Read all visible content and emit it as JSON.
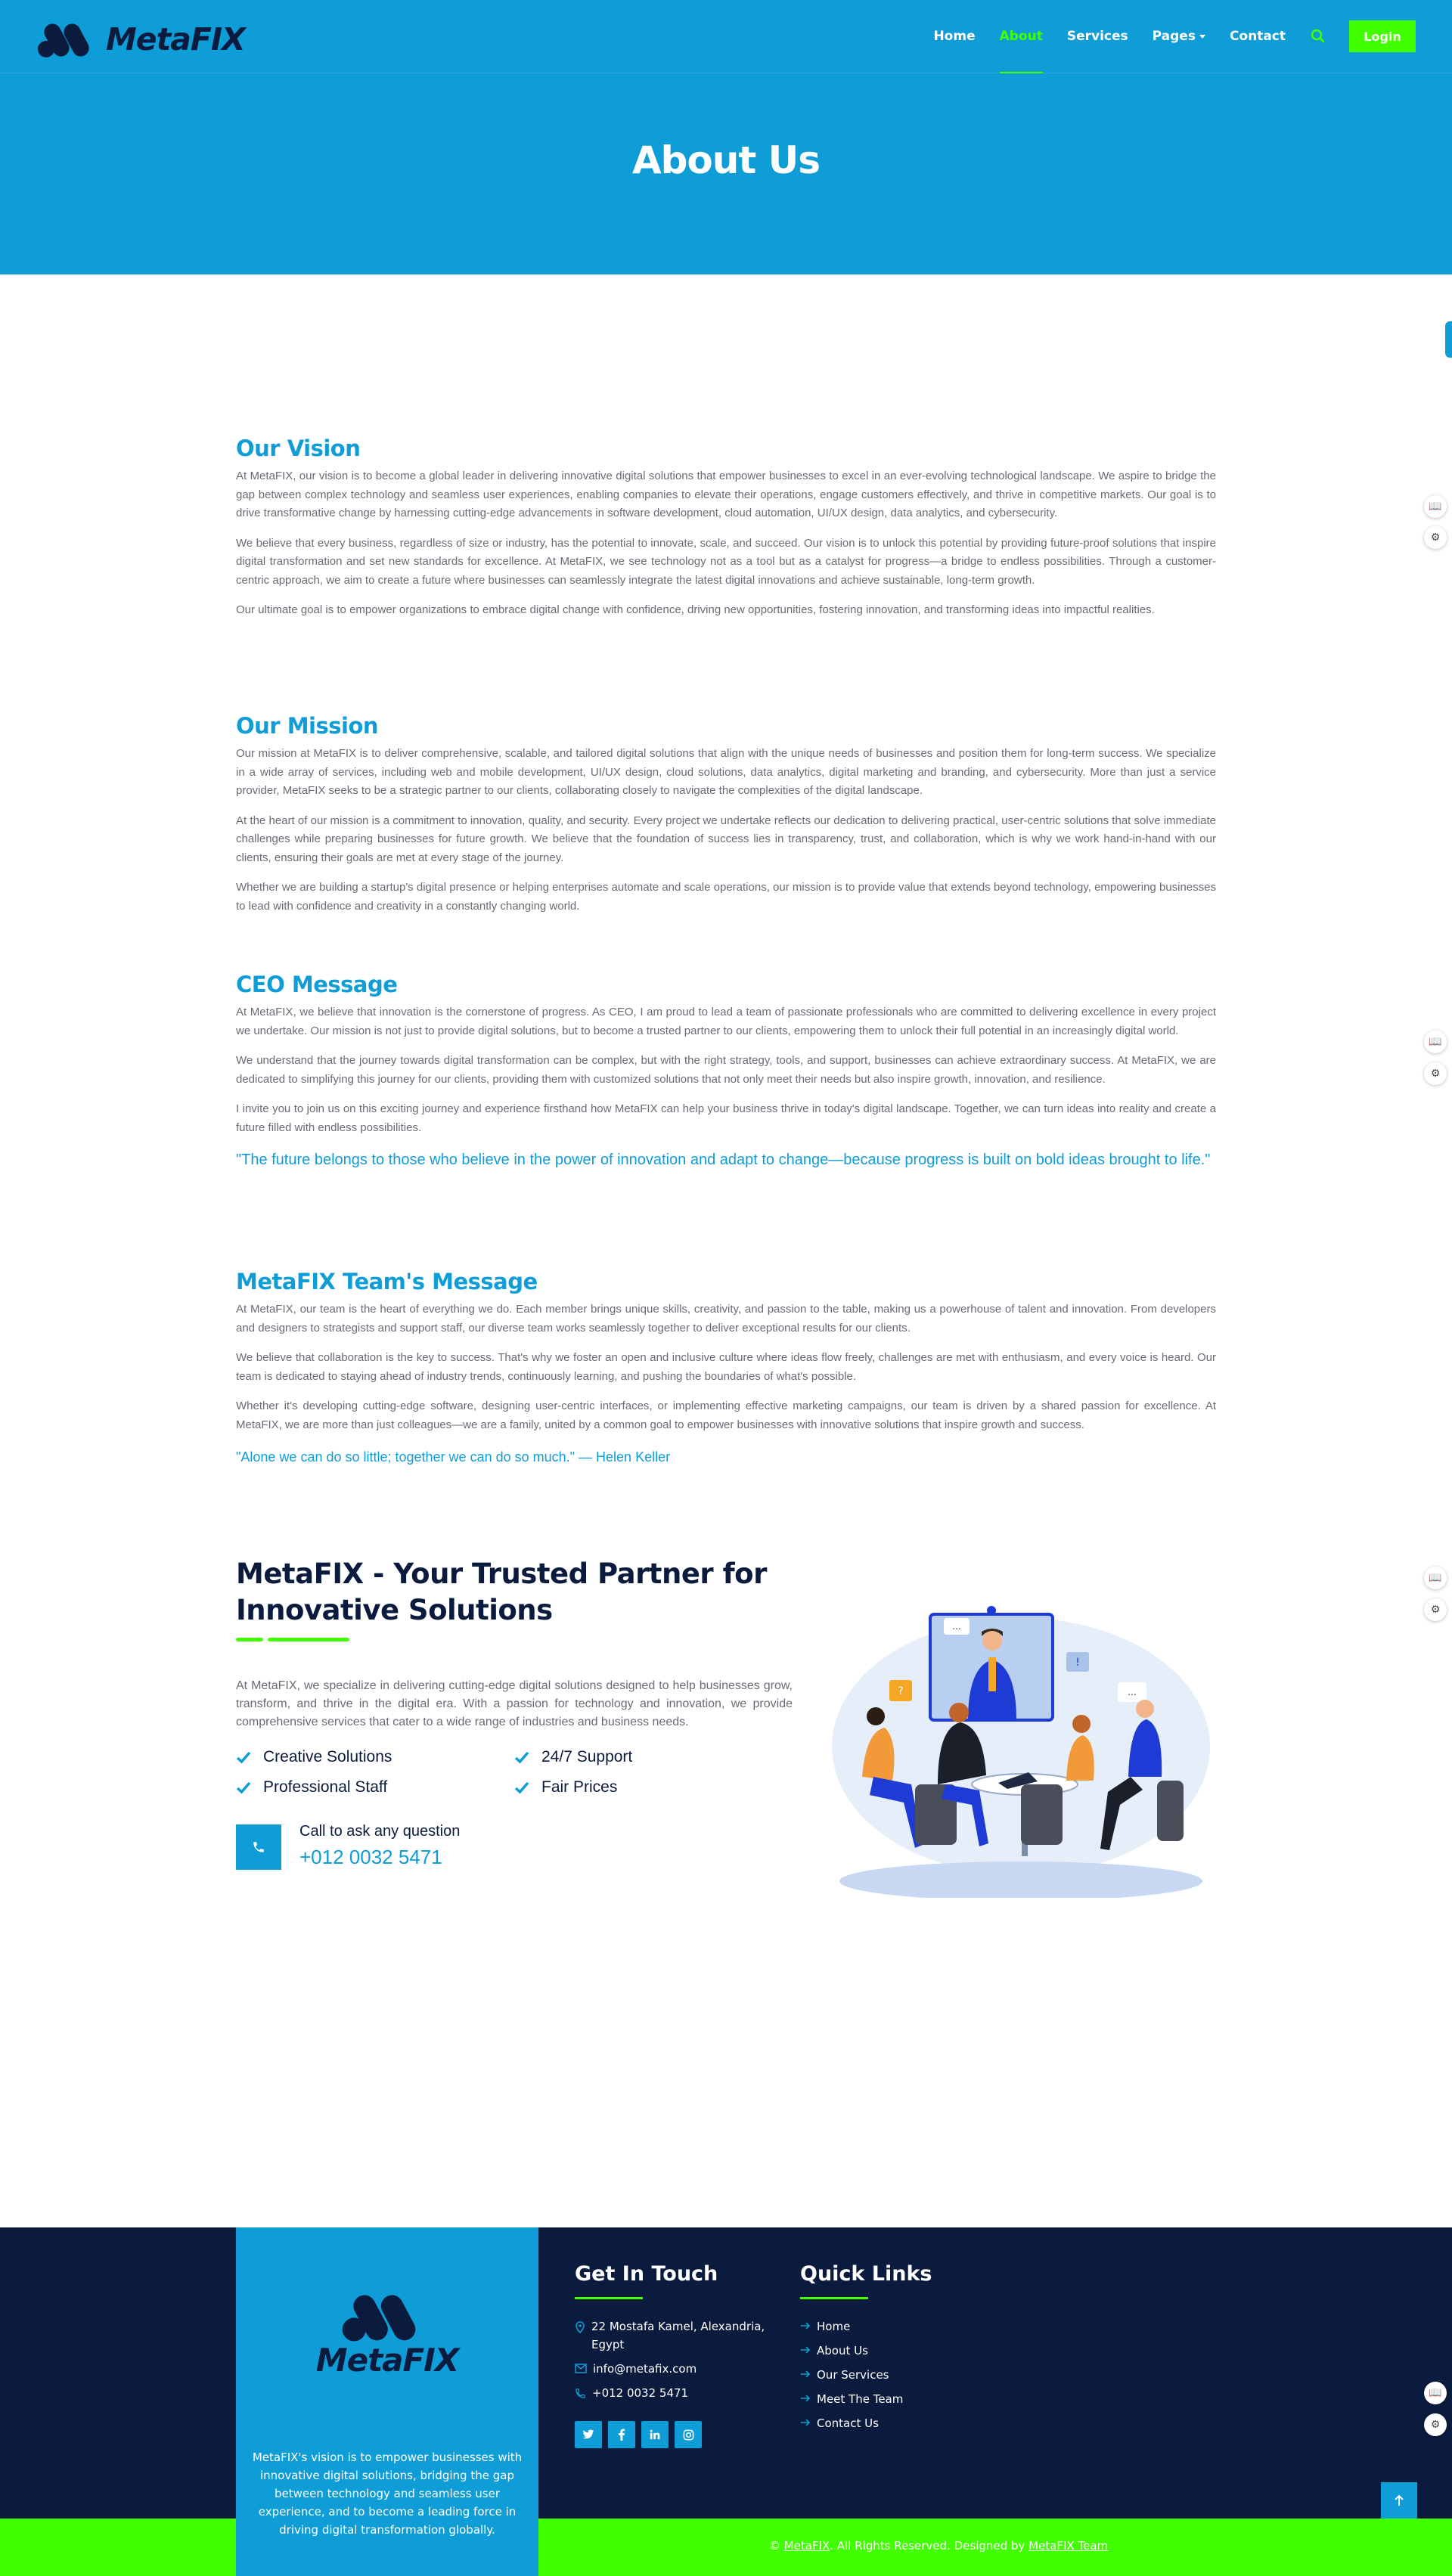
{
  "brand": {
    "name": "MetaFIX",
    "color_primary": "#0F9DD8",
    "color_accent": "#42FF00",
    "color_dark": "#0B1B3D"
  },
  "nav": {
    "items": [
      {
        "label": "Home",
        "active": false
      },
      {
        "label": "About",
        "active": true
      },
      {
        "label": "Services",
        "active": false
      },
      {
        "label": "Pages",
        "active": false
      },
      {
        "label": "Contact",
        "active": false
      }
    ],
    "search_icon": "search-icon",
    "login_label": "Login"
  },
  "hero": {
    "title": "About Us"
  },
  "vision": {
    "title": "Our Vision",
    "paragraphs": [
      "At MetaFIX, our vision is to become a global leader in delivering innovative digital solutions that empower businesses to excel in an ever-evolving technological landscape. We aspire to bridge the gap between complex technology and seamless user experiences, enabling companies to elevate their operations, engage customers effectively, and thrive in competitive markets. Our goal is to drive transformative change by harnessing cutting-edge advancements in software development, cloud automation, UI/UX design, data analytics, and cybersecurity.",
      "We believe that every business, regardless of size or industry, has the potential to innovate, scale, and succeed. Our vision is to unlock this potential by providing future-proof solutions that inspire digital transformation and set new standards for excellence. At MetaFIX, we see technology not as a tool but as a catalyst for progress—a bridge to endless possibilities. Through a customer-centric approach, we aim to create a future where businesses can seamlessly integrate the latest digital innovations and achieve sustainable, long-term growth.",
      "Our ultimate goal is to empower organizations to embrace digital change with confidence, driving new opportunities, fostering innovation, and transforming ideas into impactful realities."
    ]
  },
  "mission": {
    "title": "Our Mission",
    "paragraphs": [
      "Our mission at MetaFIX is to deliver comprehensive, scalable, and tailored digital solutions that align with the unique needs of businesses and position them for long-term success. We specialize in a wide array of services, including web and mobile development, UI/UX design, cloud solutions, data analytics, digital marketing and branding, and cybersecurity. More than just a service provider, MetaFIX seeks to be a strategic partner to our clients, collaborating closely to navigate the complexities of the digital landscape.",
      "At the heart of our mission is a commitment to innovation, quality, and security. Every project we undertake reflects our dedication to delivering practical, user-centric solutions that solve immediate challenges while preparing businesses for future growth. We believe that the foundation of success lies in transparency, trust, and collaboration, which is why we work hand-in-hand with our clients, ensuring their goals are met at every stage of the journey.",
      "Whether we are building a startup's digital presence or helping enterprises automate and scale operations, our mission is to provide value that extends beyond technology, empowering businesses to lead with confidence and creativity in a constantly changing world."
    ]
  },
  "ceo": {
    "title": "CEO Message",
    "paragraphs": [
      "At MetaFIX, we believe that innovation is the cornerstone of progress. As CEO, I am proud to lead a team of passionate professionals who are committed to delivering excellence in every project we undertake. Our mission is not just to provide digital solutions, but to become a trusted partner to our clients, empowering them to unlock their full potential in an increasingly digital world.",
      "We understand that the journey towards digital transformation can be complex, but with the right strategy, tools, and support, businesses can achieve extraordinary success. At MetaFIX, we are dedicated to simplifying this journey for our clients, providing them with customized solutions that not only meet their needs but also inspire growth, innovation, and resilience.",
      "I invite you to join us on this exciting journey and experience firsthand how MetaFIX can help your business thrive in today's digital landscape. Together, we can turn ideas into reality and create a future filled with endless possibilities."
    ],
    "quote": "\"The future belongs to those who believe in the power of innovation and adapt to change—because progress is built on bold ideas brought to life.\""
  },
  "team": {
    "title": "MetaFIX Team's Message",
    "paragraphs": [
      "At MetaFIX, our team is the heart of everything we do. Each member brings unique skills, creativity, and passion to the table, making us a powerhouse of talent and innovation. From developers and designers to strategists and support staff, our diverse team works seamlessly together to deliver exceptional results for our clients.",
      "We believe that collaboration is the key to success. That's why we foster an open and inclusive culture where ideas flow freely, challenges are met with enthusiasm, and every voice is heard. Our team is dedicated to staying ahead of industry trends, continuously learning, and pushing the boundaries of what's possible.",
      "Whether it's developing cutting-edge software, designing user-centric interfaces, or implementing effective marketing campaigns, our team is driven by a shared passion for excellence. At MetaFIX, we are more than just colleagues—we are a family, united by a common goal to empower businesses with innovative solutions that inspire growth and success."
    ],
    "quote": "\"Alone we can do so little; together we can do so much.\" — Helen Keller"
  },
  "about": {
    "title_line1": "MetaFIX - Your Trusted Partner for",
    "title_line2": "Innovative Solutions",
    "text": "At MetaFIX, we specialize in delivering cutting-edge digital solutions designed to help businesses grow, transform, and thrive in the digital era. With a passion for technology and innovation, we provide comprehensive services that cater to a wide range of industries and business needs.",
    "features": [
      "Creative Solutions",
      "24/7 Support",
      "Professional Staff",
      "Fair Prices"
    ],
    "call_label": "Call to ask any question",
    "call_number": "+012 0032 5471"
  },
  "footer": {
    "brand_name": "MetaFIX",
    "description": "MetaFIX's vision is to empower businesses with innovative digital solutions, bridging the gap between technology and seamless user experience, and to become a leading force in driving digital transformation globally.",
    "contact_title": "Get In Touch",
    "address": "22 Mostafa Kamel, Alexandria, Egypt",
    "email": "info@metafix.com",
    "phone": "+012 0032 5471",
    "social": [
      "twitter-icon",
      "facebook-icon",
      "linkedin-icon",
      "instagram-icon"
    ],
    "links_title": "Quick Links",
    "links": [
      "Home",
      "About Us",
      "Our Services",
      "Meet The Team",
      "Contact Us"
    ],
    "copyright_prefix": "©",
    "copyright_brand": "MetaFIX",
    "copyright_mid": ". All Rights Reserved. Designed by",
    "copyright_designer": "MetaFIX Team"
  }
}
